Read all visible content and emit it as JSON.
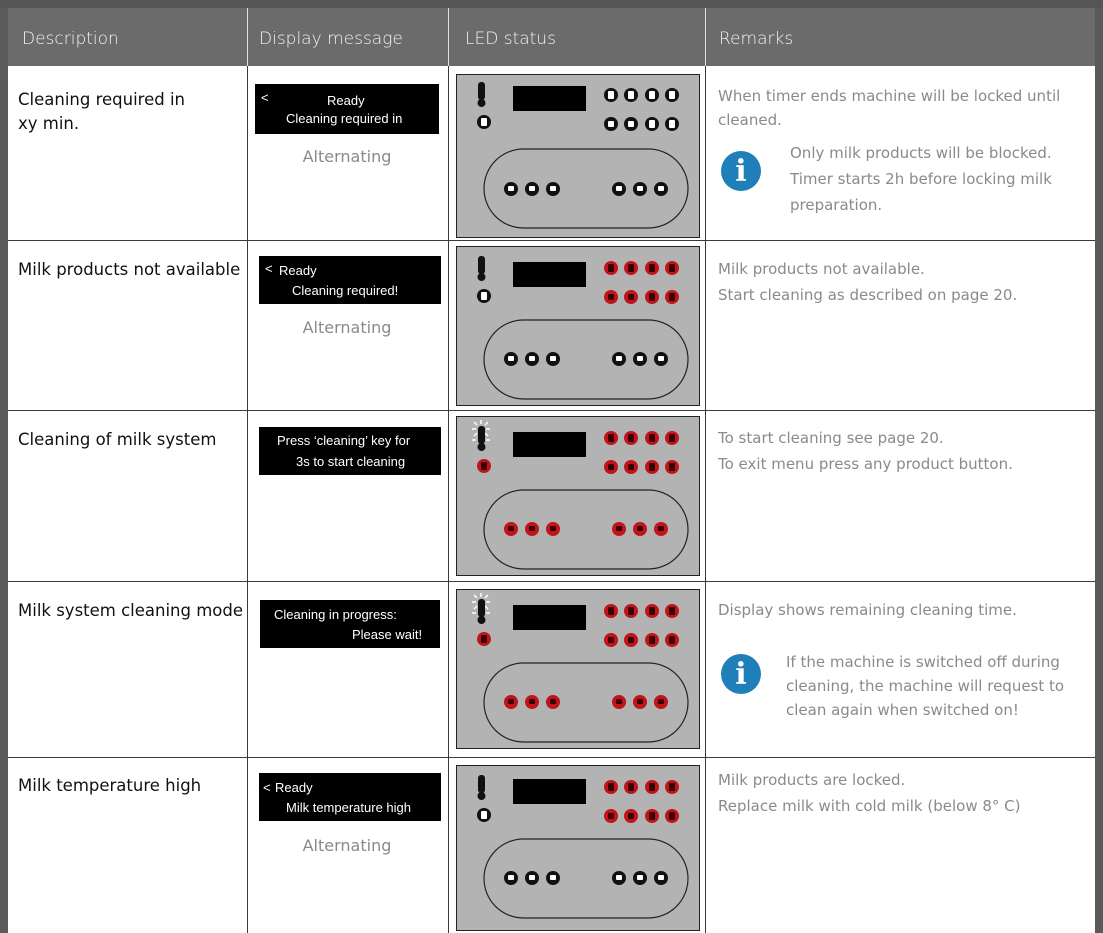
{
  "header": {
    "description": "Description",
    "display": "Display message",
    "led": "LED status",
    "remarks": "Remarks"
  },
  "rows": [
    {
      "desc_line1": "Cleaning required in",
      "desc_line2": "xy min.",
      "display_back": "<",
      "display_line1": "Ready",
      "display_line2": "Cleaning required in",
      "alternating": "Alternating",
      "remark1": "When timer ends machine will be locked until",
      "remark2": "cleaned.",
      "info1": "Only milk products will be blocked.",
      "info2": "Timer starts 2h before locking milk",
      "info3": "preparation."
    },
    {
      "desc_line1": "Milk products not available",
      "display_back": "<",
      "display_line1": "Ready",
      "display_line2": "Cleaning required!",
      "alternating": "Alternating",
      "remark1": "Milk products not available.",
      "remark2": "Start cleaning as described on page 20."
    },
    {
      "desc_line1": "Cleaning of milk system",
      "display_line1": "Press ‘cleaning’ key for",
      "display_line2": "3s to start cleaning",
      "remark1": "To start cleaning see page 20.",
      "remark2": "To exit menu press any product button."
    },
    {
      "desc_line1": "Milk system cleaning mode",
      "display_line1": "Cleaning in progress:",
      "display_line2": "Please wait!",
      "remark1": "Display shows remaining cleaning time.",
      "info1": "If the machine is switched off during",
      "info2": "cleaning, the machine will request to",
      "info3": "clean again when switched on!"
    },
    {
      "desc_line1": "Milk temperature high",
      "display_back": "<",
      "display_line1": "Ready",
      "display_line2": "Milk temperature high",
      "alternating": "Alternating",
      "remark1": "Milk products are locked.",
      "remark2": "Replace milk with cold milk (below 8° C)"
    }
  ],
  "info_glyph": "i",
  "colors": {
    "header_bg": "#6b6b6b",
    "info_blue": "#1f7fb8",
    "led_red": "#c0141a",
    "panel_gray": "#b3b3b3"
  }
}
